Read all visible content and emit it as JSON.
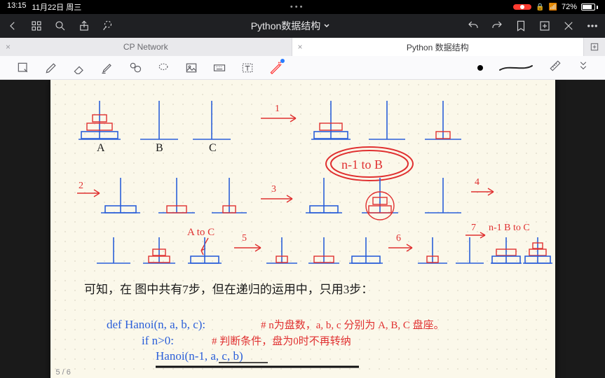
{
  "status": {
    "time": "13:15",
    "date": "11月22日 周三",
    "battery_pct": "72%"
  },
  "nav": {
    "title": "Python数据结构"
  },
  "tabs": {
    "items": [
      {
        "label": "CP Network",
        "active": false
      },
      {
        "label": "Python 数据结构",
        "active": true
      }
    ]
  },
  "page_indicator": "5 / 6",
  "note": {
    "pegLabels": {
      "a": "A",
      "b": "B",
      "c": "C"
    },
    "step1": "1",
    "step2": "2",
    "step3": "3",
    "step4": "4",
    "step5": "5",
    "step6": "6",
    "step7": "7",
    "circled": "n-1 to B",
    "moveAC": "A to C",
    "moveBC": "n-1 B to C",
    "bodyText": "可知，在 图中共有7步，但在递归的运用中，只用3步：",
    "code1": "def Hanoi(n, a, b, c):",
    "code2": "if n>0:",
    "code3": "Hanoi(n-1, a, c, b)",
    "comment1": "# n为盘数，a, b, c 分别为 A, B, C 盘座。",
    "comment2": "# 判断条件，盘为0时不再转纳"
  }
}
